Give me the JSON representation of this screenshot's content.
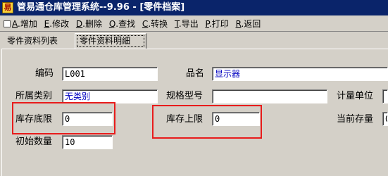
{
  "window": {
    "title": "管易通仓库管理系统--9.96 - [零件档案]"
  },
  "toolbar": {
    "items": [
      {
        "key": "A",
        "label": ".增加"
      },
      {
        "key": "E",
        "label": ".修改"
      },
      {
        "key": "D",
        "label": ".删除"
      },
      {
        "key": "Q",
        "label": ".查找"
      },
      {
        "key": "C",
        "label": ".转换"
      },
      {
        "key": "T",
        "label": ".导出"
      },
      {
        "key": "P",
        "label": ".打印"
      },
      {
        "key": "R",
        "label": ".返回"
      }
    ]
  },
  "tabs": [
    {
      "label": "零件资料列表",
      "active": false
    },
    {
      "label": "零件资料明細",
      "active": true
    }
  ],
  "form": {
    "code": {
      "label": "编码",
      "value": "L001"
    },
    "name": {
      "label": "品名",
      "value": "显示器"
    },
    "category": {
      "label": "所属类别",
      "value": "无类别"
    },
    "spec": {
      "label": "规格型号",
      "value": ""
    },
    "unit": {
      "label": "计量单位",
      "value": ""
    },
    "min_stock": {
      "label": "库存底限",
      "value": "0"
    },
    "max_stock": {
      "label": "库存上限",
      "value": "0"
    },
    "current_stock": {
      "label": "当前存量",
      "value": "0"
    },
    "initial_qty": {
      "label": "初始数量",
      "value": "10"
    }
  },
  "highlight_color": "#e81c1c"
}
